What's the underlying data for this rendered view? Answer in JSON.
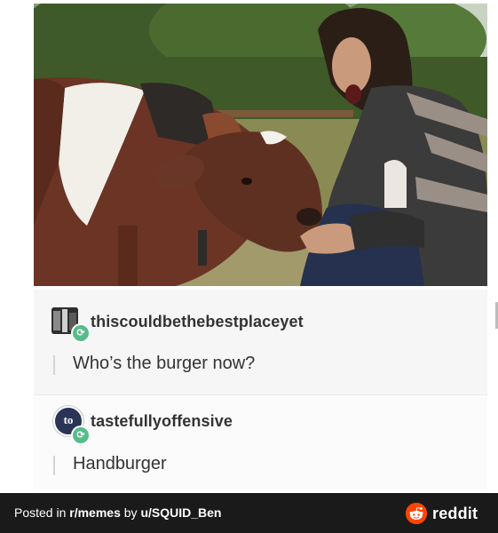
{
  "post": {
    "photo_alt": "",
    "reblogs": [
      {
        "username": "thiscouldbethebestplaceyet",
        "text": "Who’s the burger now?",
        "avatar_icon": "photo-avatar-icon",
        "badge_icon": "reblog-icon",
        "badge_glyph": "⟳"
      },
      {
        "username": "tastefullyoffensive",
        "text": "Handburger",
        "avatar_icon": "to-avatar-icon",
        "avatar_letters": "to",
        "badge_icon": "reblog-icon",
        "badge_glyph": "⟳"
      }
    ]
  },
  "footer": {
    "posted_in_prefix": "Posted in ",
    "subreddit": "r/memes",
    "by_text": " by ",
    "user": "u/SQUID_Ben",
    "brand_word": "reddit",
    "brand_color": "#ff4500"
  }
}
